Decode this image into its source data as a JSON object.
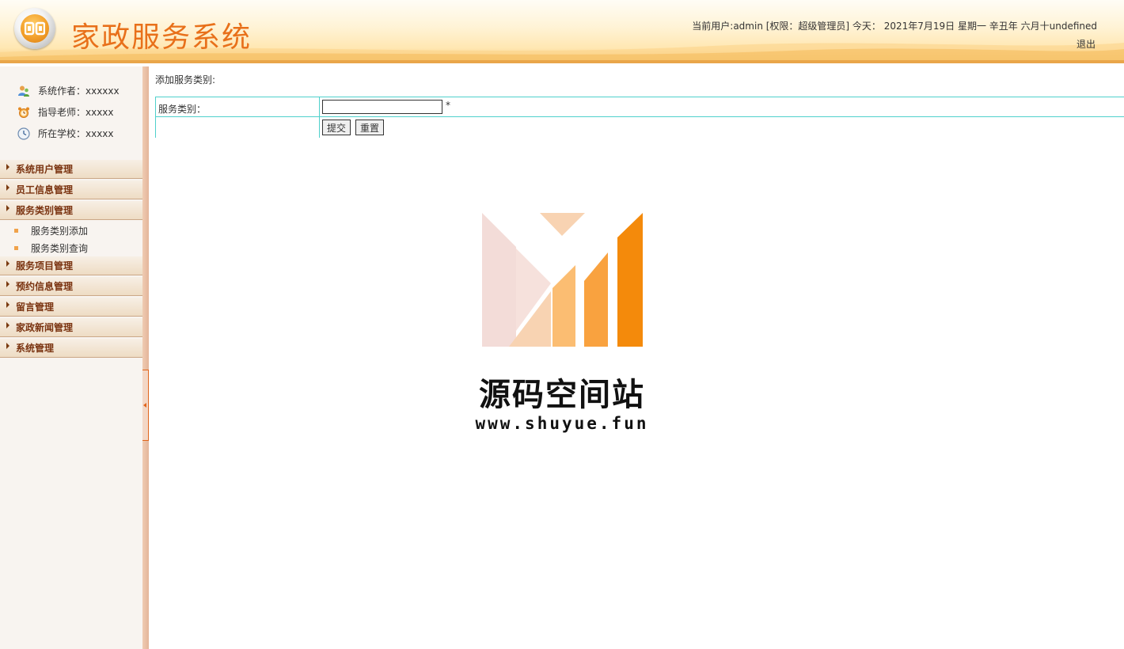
{
  "header": {
    "title": "家政服务系统",
    "user_info": "当前用户:admin [权限：超级管理员] 今天：  2021年7月19日 星期一 辛丑年 六月十undefined",
    "logout": "退出"
  },
  "sidebar": {
    "info": [
      {
        "label": "系统作者：xxxxxx",
        "icon": "user-icon"
      },
      {
        "label": "指导老师：xxxxx",
        "icon": "alarm-clock-icon"
      },
      {
        "label": "所在学校：xxxxx",
        "icon": "clock-icon"
      }
    ],
    "menus": [
      {
        "label": "系统用户管理"
      },
      {
        "label": "员工信息管理"
      },
      {
        "label": "服务类别管理",
        "expanded": true,
        "items": [
          "服务类别添加",
          "服务类别查询"
        ]
      },
      {
        "label": "服务项目管理"
      },
      {
        "label": "预约信息管理"
      },
      {
        "label": "留言管理"
      },
      {
        "label": "家政新闻管理"
      },
      {
        "label": "系统管理"
      }
    ]
  },
  "main": {
    "section_title": "添加服务类别:",
    "form": {
      "field_label": "服务类别：",
      "field_value": "",
      "required_mark": "*",
      "submit_label": "提交",
      "reset_label": "重置"
    }
  },
  "watermark": {
    "name": "源码空间站",
    "url": "www.shuyue.fun",
    "colors": [
      "#f3dcd8",
      "#f8d3b2",
      "#fbbd72",
      "#f9a23f",
      "#f48a0b"
    ]
  }
}
